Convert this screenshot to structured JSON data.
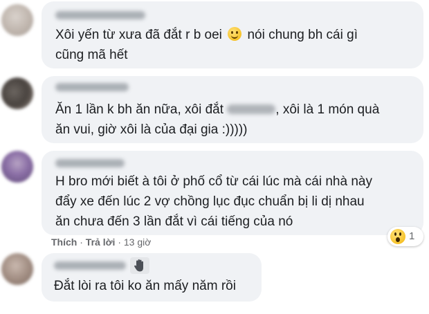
{
  "comments": [
    {
      "text_line1_before": "Xôi yến từ xưa đã đắt r b oei",
      "emoji": "smiling-face-icon",
      "text_line1_after": "nói chung bh cái gì",
      "text_line2": "cũng mã hết"
    },
    {
      "text_line1_before": "Ăn 1 lần k bh ăn nữa, xôi đắt",
      "text_line1_after": ", xôi là 1 món quà",
      "text_line2": "ăn vui, giờ xôi là của đại gia :)))))"
    },
    {
      "text_line1": "H bro mới biết à tôi ở phố cổ từ cái lúc mà cái nhà này",
      "text_line2": "đẩy xe đến lúc 2 vợ chồng lục đục chuẩn bị li dị nhau",
      "text_line3": "ăn chưa đến 3 lần đắt vì cái tiếng của nó",
      "actions": {
        "like": "Thích",
        "sep1": " · ",
        "reply": "Trả lời",
        "sep2": " · ",
        "time": "13 giờ"
      },
      "reaction": {
        "icon": "wow-reaction-icon",
        "count": "1"
      }
    },
    {
      "emoji": "waving-hand-icon",
      "text_line1": "Đắt lòi ra tôi ko ăn mấy năm rồi"
    }
  ],
  "colors": {
    "bubble": "#f0f2f5",
    "text": "#1c1e21",
    "meta": "#65676b"
  }
}
